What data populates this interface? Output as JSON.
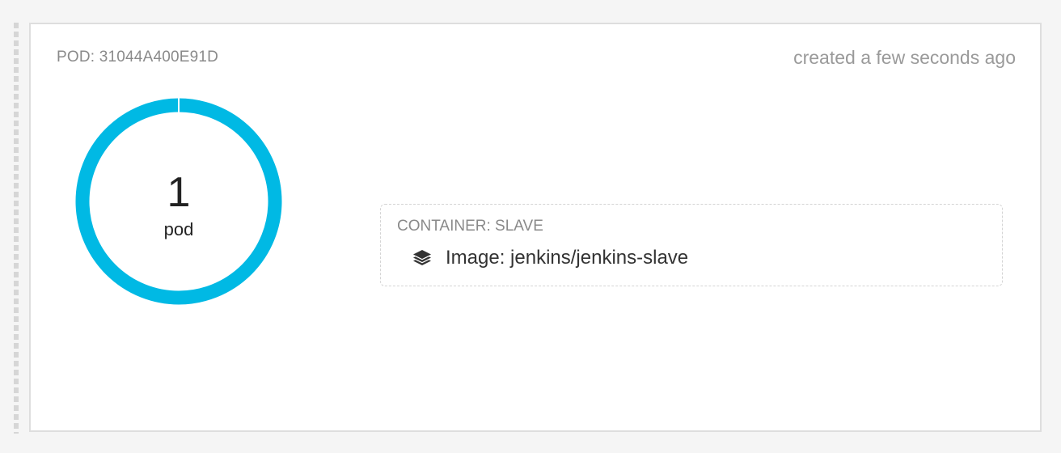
{
  "pod": {
    "title": "POD: 31044A400E91D",
    "created": "created a few seconds ago",
    "donut": {
      "count": "1",
      "unit": "pod",
      "ring_color": "#00b9e4",
      "fill_fraction": 1.0
    }
  },
  "container": {
    "title": "CONTAINER: SLAVE",
    "image_label": "Image: jenkins/jenkins-slave",
    "icon": "layers-icon"
  }
}
